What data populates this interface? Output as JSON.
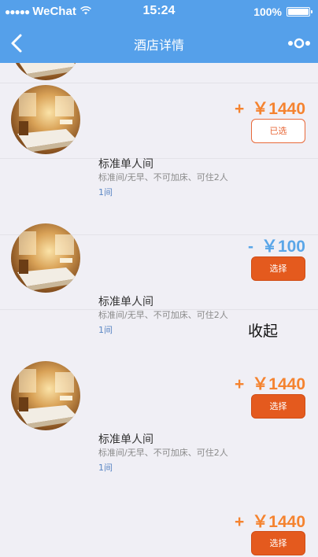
{
  "status_bar": {
    "carrier": "WeChat",
    "time": "15:24",
    "battery": "100%"
  },
  "nav": {
    "title": "酒店详情",
    "back_icon": "chevron-left-icon",
    "more_icon": "more-dots-icon"
  },
  "rooms": [
    {
      "sign": "+",
      "price": "￥1440",
      "action": "已选",
      "action_state": "selected",
      "name": "标准单人间",
      "desc": "标准间/无早、不可加床、可住2人",
      "qty": "1间"
    },
    {
      "sign": "-",
      "price": "￥100",
      "action": "选择",
      "action_state": "select",
      "name": "标准单人间",
      "desc": "标准间/无早、不可加床、可住2人",
      "qty": "1间"
    },
    {
      "sign": "+",
      "price": "￥1440",
      "action": "选择",
      "action_state": "select",
      "name": "标准单人间",
      "desc": "标准间/无早、不可加床、可住2人",
      "qty": "1间"
    },
    {
      "sign": "+",
      "price": "￥1440",
      "action": "选择",
      "action_state": "select"
    }
  ],
  "collapse_label": "收起",
  "colors": {
    "header": "#55a0ea",
    "price_plus": "#f5832f",
    "price_minus": "#5aa6e8",
    "button": "#e45a1e",
    "background": "#f0eff5"
  }
}
